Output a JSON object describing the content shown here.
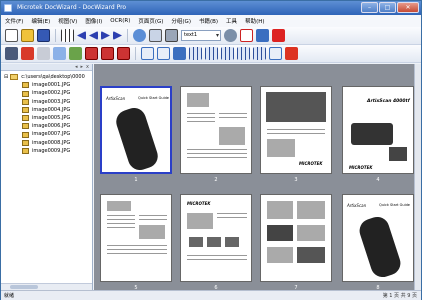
{
  "window": {
    "title": "Microtek DocWizard - DocWizard Pro",
    "min": "–",
    "max": "□",
    "close": "✕"
  },
  "menu": [
    "文件(F)",
    "编辑(E)",
    "视图(V)",
    "图像(I)",
    "OCR(R)",
    "页面页(G)",
    "分组(G)",
    "书籍(B)",
    "工具",
    "帮助(H)"
  ],
  "toolbar1": {
    "zoom_value": "text1"
  },
  "tree": {
    "header_icons": [
      "◂",
      "▸",
      "x"
    ],
    "root": "c:\\users\\qa\\desktop\\0000",
    "files": [
      "image0001.JPG",
      "image0002.JPG",
      "image0003.JPG",
      "image0004.JPG",
      "image0005.JPG",
      "image0006.JPG",
      "image0007.JPG",
      "image0008.JPG",
      "image0009.JPG"
    ]
  },
  "thumbnails": {
    "labels": [
      "1",
      "2",
      "3",
      "4",
      "5",
      "6",
      "7",
      "8"
    ],
    "texts": {
      "remote_brand": "ArtixScan",
      "remote_title": "Quick Start Guide",
      "brochure_title": "ArtixScan 4000tf",
      "brand": "MICROTEK",
      "guide_title": "Quick Start Guide"
    }
  },
  "status": {
    "left": "就绪",
    "right": "第 1 页 共 9 页"
  },
  "colors": {
    "selection": "#2a3fc8",
    "grid_bg": "#8a8f98",
    "title_bar": "#2f64b8"
  }
}
